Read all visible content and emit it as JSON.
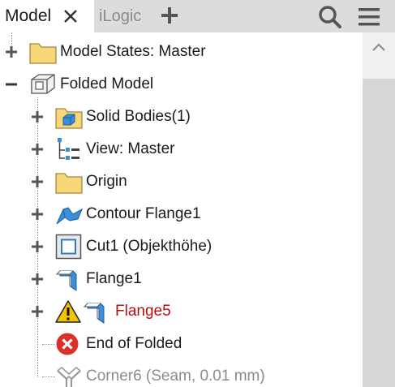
{
  "tabs": [
    {
      "label": "Model",
      "active": true
    },
    {
      "label": "iLogic",
      "active": false
    }
  ],
  "toolbar": {
    "add_icon": "plus-icon",
    "search_icon": "search-icon",
    "menu_icon": "hamburger-menu-icon"
  },
  "colors": {
    "folder_yellow": "#f7d77a",
    "error_red": "#d9312b",
    "warning_yellow": "#f5c400",
    "flange_blue": "#3b8ed8",
    "error_text": "#b50f0f",
    "suppressed_text": "#8c8c8c"
  },
  "tree": {
    "items": [
      {
        "label": "Model States: Master",
        "icon": "folder-icon",
        "expander": "plus"
      },
      {
        "label": "Folded Model",
        "icon": "sheet-metal-part-icon",
        "expander": "minus"
      },
      {
        "label": "Solid Bodies(1)",
        "icon": "solid-bodies-folder-icon",
        "expander": "plus"
      },
      {
        "label": "View: Master",
        "icon": "view-representation-icon",
        "expander": "plus"
      },
      {
        "label": "Origin",
        "icon": "folder-icon",
        "expander": "plus"
      },
      {
        "label": "Contour Flange1",
        "icon": "contour-flange-icon",
        "expander": "plus"
      },
      {
        "label": "Cut1 (Objekthöhe)",
        "icon": "cut-icon",
        "expander": "plus"
      },
      {
        "label": "Flange1",
        "icon": "flange-icon",
        "expander": "plus"
      },
      {
        "label": "Flange5",
        "icon": "flange-icon",
        "expander": "plus",
        "status": "warning"
      },
      {
        "label": "End of Folded",
        "icon": "end-of-part-error-icon",
        "expander": "none"
      },
      {
        "label": "Corner6 (Seam, 0.01 mm)",
        "icon": "corner-seam-icon",
        "expander": "none",
        "status": "suppressed"
      }
    ]
  }
}
